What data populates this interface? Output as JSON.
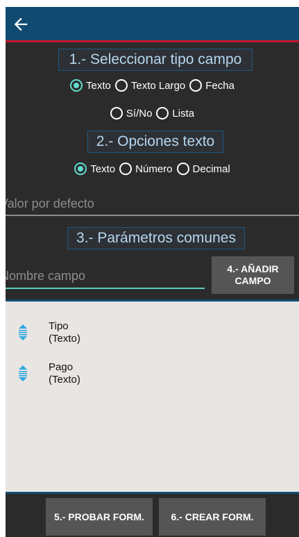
{
  "toolbar": {
    "back_icon": "arrow-left-icon"
  },
  "section1": {
    "title": "1.- Seleccionar tipo campo",
    "options_row1": [
      {
        "label": "Texto",
        "checked": true
      },
      {
        "label": "Texto Largo",
        "checked": false
      },
      {
        "label": "Fecha",
        "checked": false
      }
    ],
    "options_row2": [
      {
        "label": "Sí/No",
        "checked": false
      },
      {
        "label": "Lista",
        "checked": false
      }
    ]
  },
  "section2": {
    "title": "2.- Opciones texto",
    "options": [
      {
        "label": "Texto",
        "checked": true
      },
      {
        "label": "Número",
        "checked": false
      },
      {
        "label": "Decimal",
        "checked": false
      }
    ],
    "default_value_placeholder": "Valor por defecto"
  },
  "section3": {
    "title": "3.- Parámetros comunes",
    "field_name_placeholder": "Nombre campo",
    "add_button": "4.- AÑADIR CAMPO"
  },
  "fields": [
    {
      "name": "Tipo",
      "type": "(Texto)",
      "icon": "drag-handle-icon"
    },
    {
      "name": "Pago",
      "type": "(Texto)",
      "icon": "drag-handle-icon"
    }
  ],
  "bottom": {
    "test_button": "5.- PROBAR FORM.",
    "create_button": "6.- CREAR FORM."
  },
  "colors": {
    "toolbar": "#114a70",
    "accent": "#61dcd0",
    "background": "#2b2b2b",
    "list_background": "#e8e5e3",
    "title_text": "#b6d6ee"
  }
}
